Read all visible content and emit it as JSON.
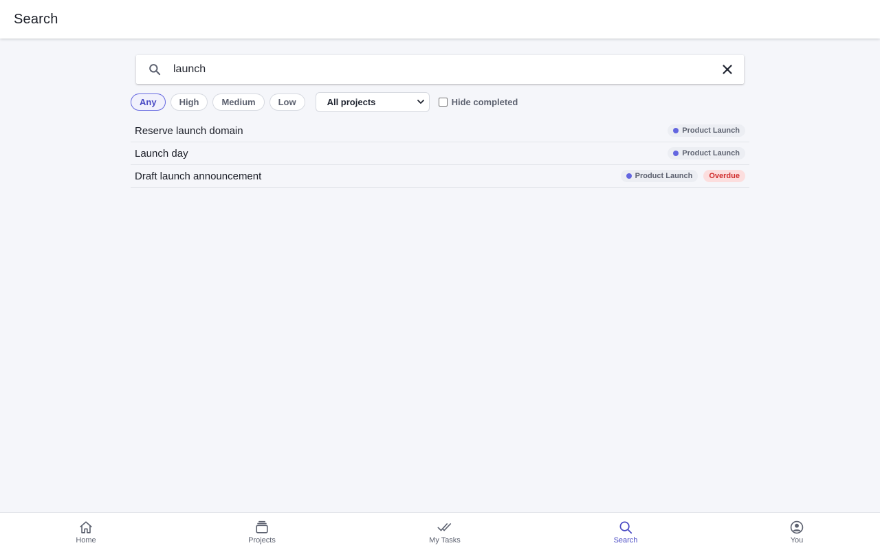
{
  "header": {
    "title": "Search"
  },
  "search": {
    "value": "launch",
    "placeholder": ""
  },
  "filters": {
    "priority_chips": [
      {
        "label": "Any",
        "selected": true
      },
      {
        "label": "High",
        "selected": false
      },
      {
        "label": "Medium",
        "selected": false
      },
      {
        "label": "Low",
        "selected": false
      }
    ],
    "project_select": {
      "value": "All projects"
    },
    "hide_completed": {
      "label": "Hide completed",
      "checked": false
    }
  },
  "results": [
    {
      "title": "Reserve launch domain",
      "project": "Product Launch",
      "badge": ""
    },
    {
      "title": "Launch day",
      "project": "Product Launch",
      "badge": ""
    },
    {
      "title": "Draft launch announcement",
      "project": "Product Launch",
      "badge": "Overdue"
    }
  ],
  "colors": {
    "accent": "#4a4bc4",
    "project_dot": "#6366e0",
    "overdue_text": "#d02d2d",
    "overdue_bg": "#fcdede"
  },
  "bottom_nav": [
    {
      "label": "Home",
      "icon": "home-icon",
      "active": false
    },
    {
      "label": "Projects",
      "icon": "projects-icon",
      "active": false
    },
    {
      "label": "My Tasks",
      "icon": "double-check-icon",
      "active": false
    },
    {
      "label": "Search",
      "icon": "search-icon",
      "active": true
    },
    {
      "label": "You",
      "icon": "account-circle-icon",
      "active": false
    }
  ]
}
